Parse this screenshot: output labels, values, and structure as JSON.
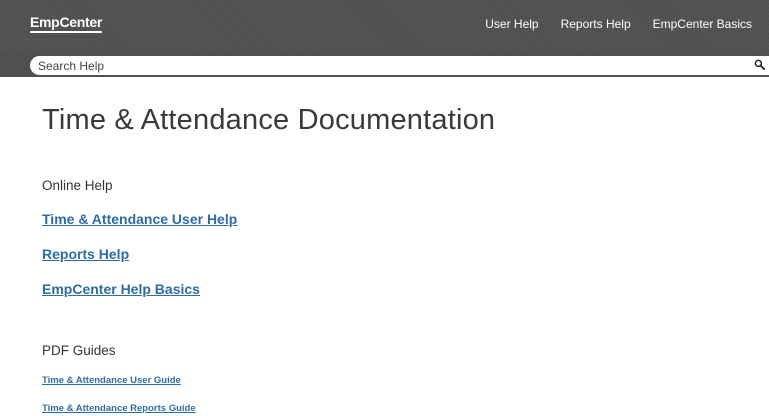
{
  "header": {
    "logo": "EmpCenter",
    "nav": [
      "User Help",
      "Reports Help",
      "EmpCenter Basics"
    ]
  },
  "search": {
    "placeholder": "Search Help",
    "icon": "search-icon"
  },
  "main": {
    "title": "Time & Attendance Documentation",
    "online_help": {
      "heading": "Online Help",
      "links": [
        "Time & Attendance User Help",
        "Reports Help",
        "EmpCenter Help Basics"
      ]
    },
    "pdf_guides": {
      "heading": "PDF Guides",
      "links": [
        "Time & Attendance User Guide",
        "Time & Attendance Reports Guide"
      ]
    }
  },
  "colors": {
    "header_bg": "#505050",
    "link": "#2e6da4"
  }
}
